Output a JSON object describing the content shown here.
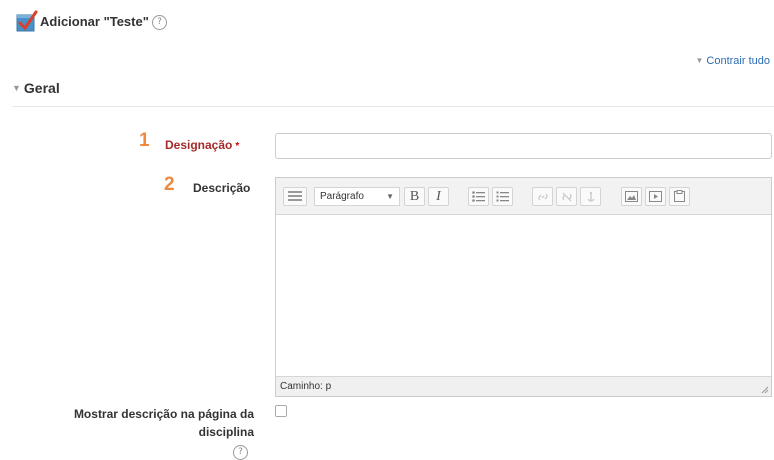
{
  "header": {
    "title": "Adicionar \"Teste\"",
    "help_icon": "?"
  },
  "collapse_all_label": "Contrair tudo",
  "section": {
    "title": "Geral"
  },
  "fields": {
    "name": {
      "step": "1",
      "label": "Designação",
      "required_mark": "*",
      "value": ""
    },
    "description": {
      "step": "2",
      "label": "Descrição"
    },
    "show_description": {
      "label_line1": "Mostrar descrição na página da",
      "label_line2": "disciplina",
      "checked": false,
      "help_icon": "?"
    }
  },
  "editor": {
    "format_select": "Parágrafo",
    "bold_label": "B",
    "italic_label": "I",
    "path_label": "Caminho: p"
  },
  "icons": {
    "title": "quiz-icon",
    "collapse": "triangle-down-icon",
    "section": "triangle-down-icon",
    "toolbar": [
      "toolbar-toggle-icon",
      "unordered-list-icon",
      "ordered-list-icon",
      "link-icon",
      "unlink-icon",
      "anchor-icon",
      "image-icon",
      "media-icon",
      "paste-icon"
    ]
  },
  "colors": {
    "accent_link": "#2b6cb0",
    "required": "#a52a2a",
    "step_number": "#f0883e"
  }
}
